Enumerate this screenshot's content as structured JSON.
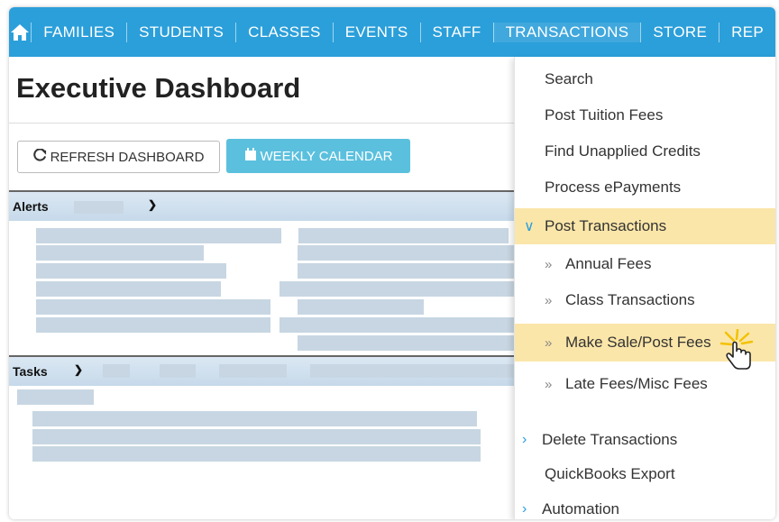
{
  "nav": {
    "items": [
      "FAMILIES",
      "STUDENTS",
      "CLASSES",
      "EVENTS",
      "STAFF",
      "TRANSACTIONS",
      "STORE",
      "REP"
    ],
    "active": "TRANSACTIONS"
  },
  "page": {
    "title": "Executive Dashboard",
    "refresh_label": "REFRESH DASHBOARD",
    "calendar_label": "WEEKLY CALENDAR"
  },
  "alerts": {
    "label": "Alerts"
  },
  "tasks": {
    "label": "Tasks"
  },
  "menu": {
    "search": "Search",
    "post_tuition": "Post Tuition Fees",
    "find_unapplied": "Find Unapplied Credits",
    "process_epayments": "Process ePayments",
    "post_transactions": "Post Transactions",
    "annual_fees": "Annual Fees",
    "class_transactions": "Class Transactions",
    "make_sale": "Make Sale/Post Fees",
    "late_fees": "Late Fees/Misc Fees",
    "delete_transactions": "Delete Transactions",
    "quickbooks_export": "QuickBooks Export",
    "automation": "Automation"
  },
  "colors": {
    "nav_bg": "#2b9fda",
    "highlight": "#fbe6a9",
    "calendar_btn": "#5bc0de"
  }
}
